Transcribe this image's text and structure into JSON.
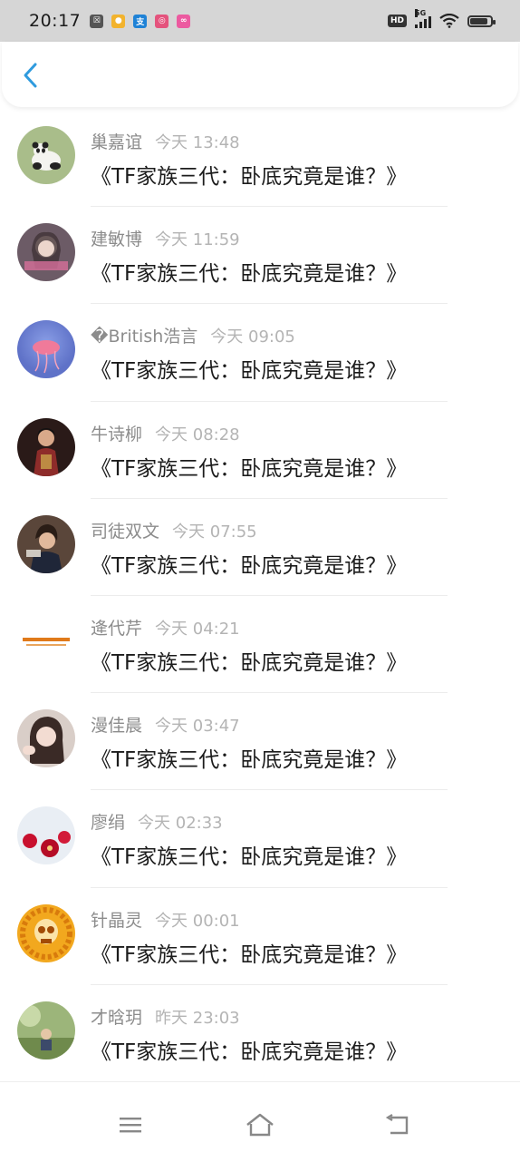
{
  "status_bar": {
    "time": "20:17",
    "network": "5G",
    "hd": "HD",
    "app_icons": [
      "notification-icon",
      "weibo-icon",
      "alipay-icon",
      "app-icon",
      "app-icon"
    ],
    "battery_percent": 85
  },
  "header": {
    "back_icon": "chevron-left-icon",
    "accent_color": "#2f9bde"
  },
  "messages": [
    {
      "name": "巢嘉谊",
      "time": "今天 13:48",
      "title": "《TF家族三代：卧底究竟是谁？》",
      "avatar": "panda-avatar"
    },
    {
      "name": "建敏博",
      "time": "今天 11:59",
      "title": "《TF家族三代：卧底究竟是谁？》",
      "avatar": "girl-avatar"
    },
    {
      "name": "�British浩言",
      "time": "今天 09:05",
      "title": "《TF家族三代：卧底究竟是谁？》",
      "avatar": "jellyfish-avatar"
    },
    {
      "name": "牛诗柳",
      "time": "今天 08:28",
      "title": "《TF家族三代：卧底究竟是谁？》",
      "avatar": "woman-avatar"
    },
    {
      "name": "司徒双文",
      "time": "今天 07:55",
      "title": "《TF家族三代：卧底究竟是谁？》",
      "avatar": "boy-avatar"
    },
    {
      "name": "逄代芹",
      "time": "今天 04:21",
      "title": "《TF家族三代：卧底究竟是谁？》",
      "avatar": "text-avatar"
    },
    {
      "name": "漫佳晨",
      "time": "今天 03:47",
      "title": "《TF家族三代：卧底究竟是谁？》",
      "avatar": "girl-avatar"
    },
    {
      "name": "廖绢",
      "time": "今天 02:33",
      "title": "《TF家族三代：卧底究竟是谁？》",
      "avatar": "flower-avatar"
    },
    {
      "name": "针晶灵",
      "time": "今天 00:01",
      "title": "《TF家族三代：卧底究竟是谁？》",
      "avatar": "skull-avatar"
    },
    {
      "name": "才晗玥",
      "time": "昨天 23:03",
      "title": "《TF家族三代：卧底究竟是谁？》",
      "avatar": "nature-avatar"
    }
  ],
  "nav_bar": {
    "menu_icon": "menu-icon",
    "home_icon": "home-icon",
    "back_icon": "back-icon"
  }
}
